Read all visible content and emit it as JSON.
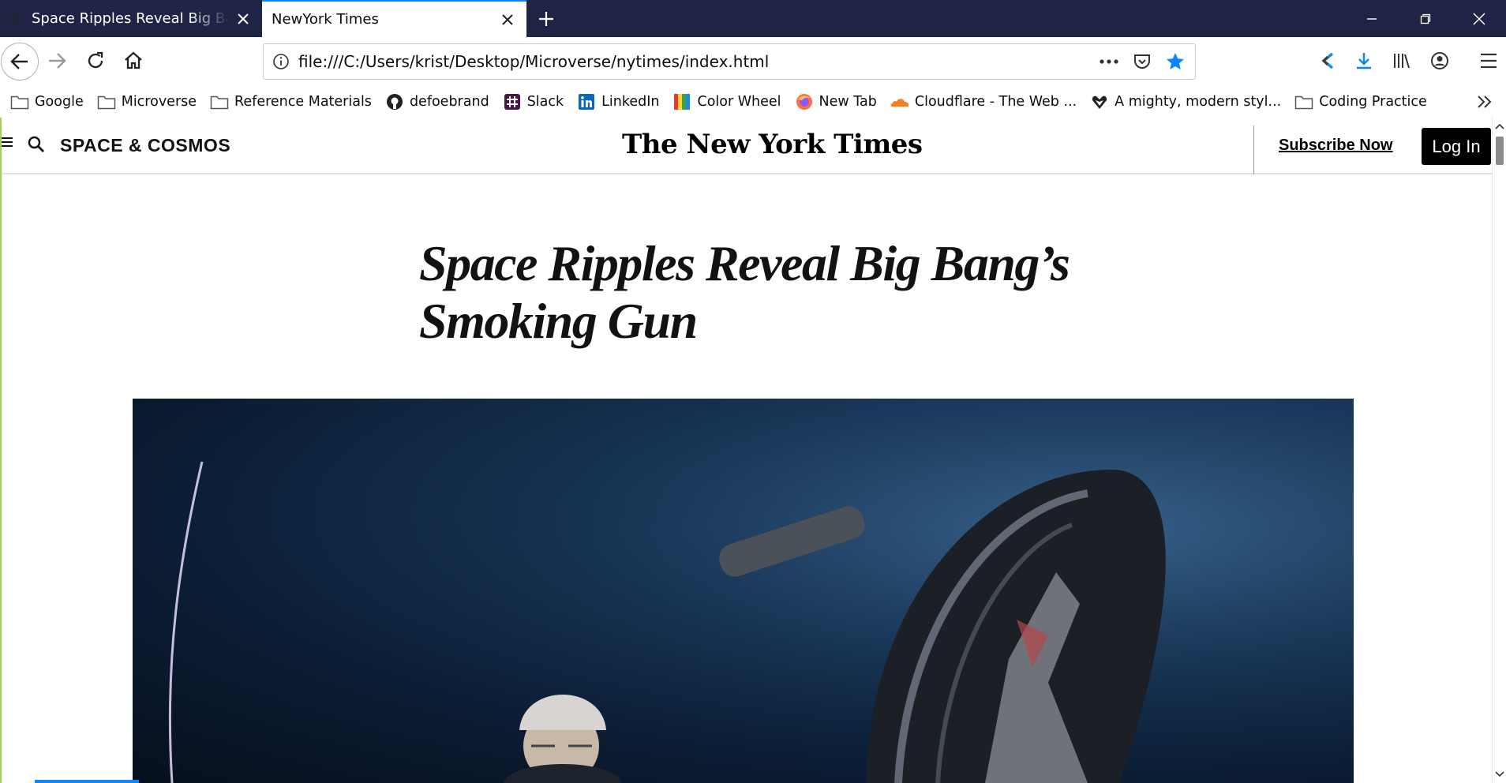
{
  "tabs": [
    {
      "title": "Space Ripples Reveal Big Bang's Smoking Gun",
      "favicon": "nyt-favicon",
      "active": false
    },
    {
      "title": "NewYork Times",
      "active": true
    }
  ],
  "address_bar": {
    "url": "file:///C:/Users/krist/Desktop/Microverse/nytimes/index.html"
  },
  "bookmarks": [
    {
      "label": "Google",
      "icon": "folder-icon"
    },
    {
      "label": "Microverse",
      "icon": "folder-icon"
    },
    {
      "label": "Reference Materials",
      "icon": "folder-icon"
    },
    {
      "label": "defoebrand",
      "icon": "github-icon"
    },
    {
      "label": "Slack",
      "icon": "slack-icon"
    },
    {
      "label": "LinkedIn",
      "icon": "linkedin-icon"
    },
    {
      "label": "Color Wheel",
      "icon": "color-wheel-icon"
    },
    {
      "label": "New Tab",
      "icon": "firefox-icon"
    },
    {
      "label": "Cloudflare - The Web ...",
      "icon": "cloudflare-icon"
    },
    {
      "label": "A mighty, modern styl...",
      "icon": "heart-logo-icon"
    },
    {
      "label": "Coding Practice",
      "icon": "folder-icon"
    }
  ],
  "site": {
    "section": "SPACE & COSMOS",
    "masthead": "The New York Times",
    "subscribe_label": "Subscribe Now",
    "login_label": "Log In"
  },
  "article": {
    "headline_line1": "Space Ripples Reveal Big Bang’s",
    "headline_line2": "Smoking Gun"
  },
  "colors": {
    "tabstrip_bg": "#1f2444",
    "accent": "#0a84ff",
    "hero_bg": "#0b1c33"
  }
}
